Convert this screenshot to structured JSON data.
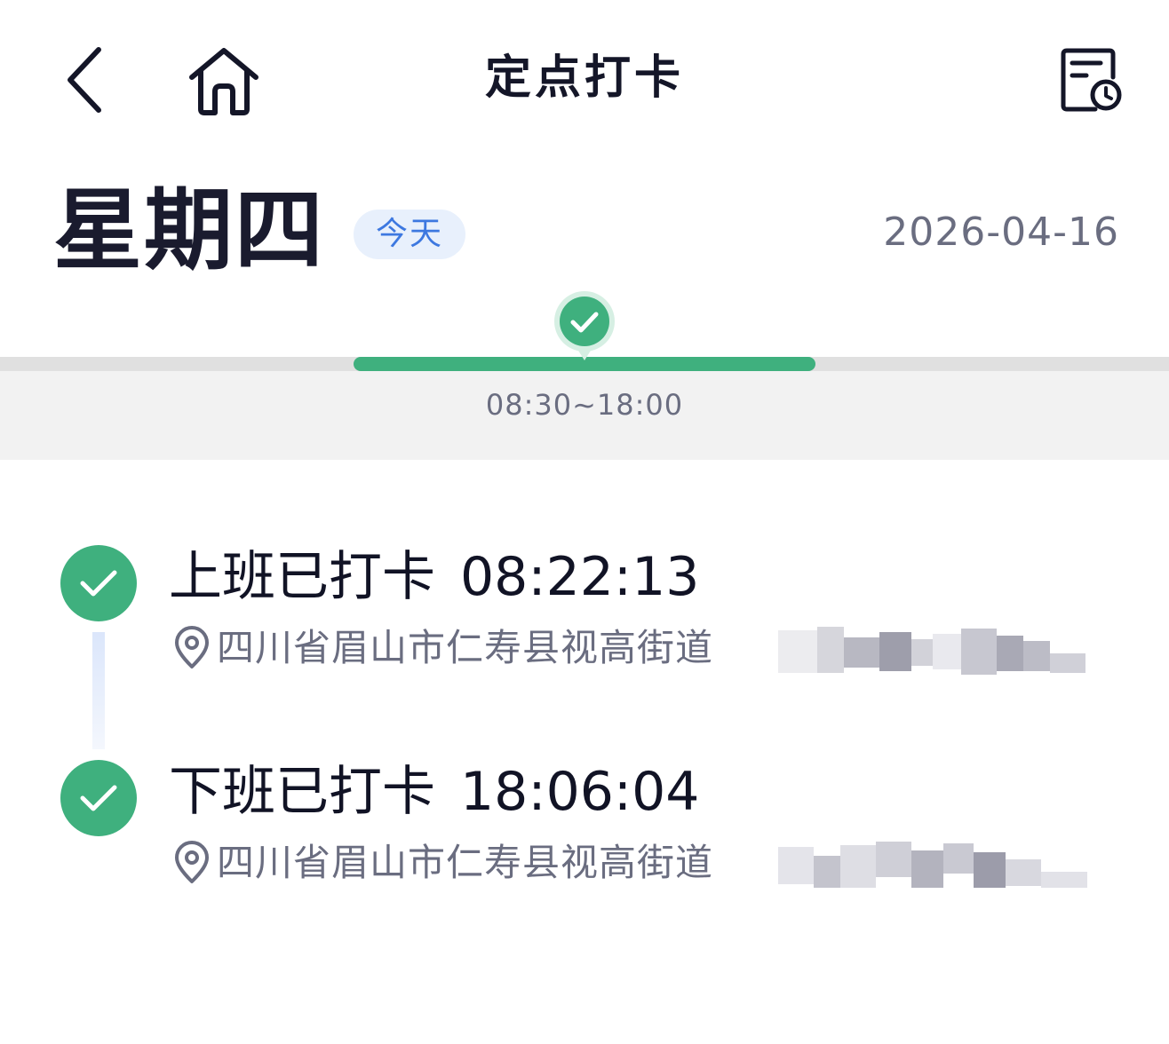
{
  "header": {
    "title": "定点打卡",
    "back_icon": "chevron-left-icon",
    "home_icon": "home-icon",
    "record_icon": "document-clock-icon"
  },
  "date_row": {
    "weekday": "星期四",
    "today_label": "今天",
    "date": "2026-04-16"
  },
  "schedule": {
    "shift_time": "08:30~18:00",
    "accent_color": "#3fb07e"
  },
  "records": [
    {
      "title": "上班已打卡",
      "time": "08:22:13",
      "address": "四川省眉山市仁寿县视高街道"
    },
    {
      "title": "下班已打卡",
      "time": "18:06:04",
      "address": "四川省眉山市仁寿县视高街道"
    }
  ]
}
